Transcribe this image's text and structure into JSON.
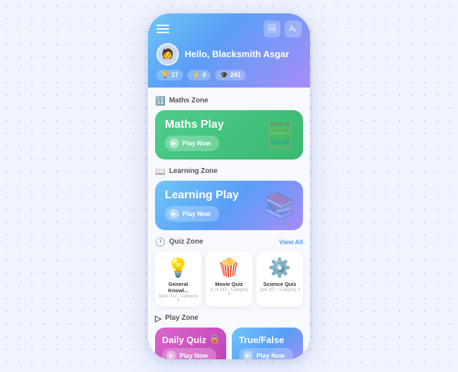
{
  "background": {
    "dot_color": "#b0c8f0"
  },
  "header": {
    "greeting": "Hello, Blacksmith Asgar",
    "stat1_icon": "🏆",
    "stat1_value": "17",
    "stat2_icon": "⚡",
    "stat2_value": "0",
    "stat3_icon": "🎓",
    "stat3_value": "241",
    "icon1": "🖼",
    "icon2": "A"
  },
  "sections": {
    "maths_zone": {
      "label": "Maths Zone",
      "card_title": "Maths Play",
      "play_btn": "Play Now",
      "bg_icon": "🧮"
    },
    "learning_zone": {
      "label": "Learning Zone",
      "card_title": "Learning Play",
      "play_btn": "Play Now",
      "bg_icon": "📚"
    },
    "quiz_zone": {
      "label": "Quiz Zone",
      "view_all": "View All",
      "cards": [
        {
          "emoji": "💡",
          "title": "General Knowl...",
          "sub": "Ques 312 · Category 3"
        },
        {
          "emoji": "🍿",
          "title": "Movie Quiz",
          "sub": "Q.sk 141 · Category 3"
        },
        {
          "emoji": "⚙️",
          "title": "Science Quiz",
          "sub": "Que 207 · Category 3"
        }
      ]
    },
    "play_zone": {
      "label": "Play Zone",
      "daily_quiz": {
        "title": "Daily Quiz",
        "play_btn": "Play Now"
      },
      "true_false": {
        "title": "True/False",
        "play_btn": "Play Now"
      }
    }
  }
}
